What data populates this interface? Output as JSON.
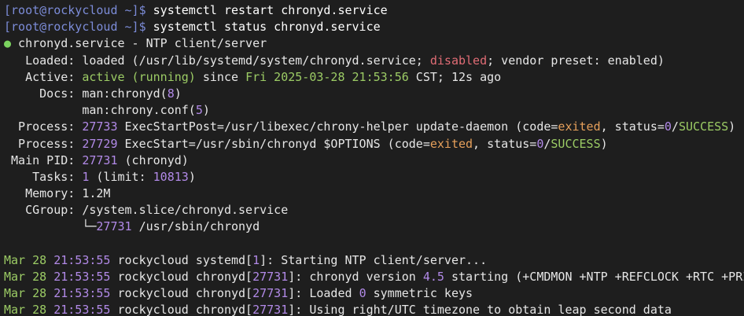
{
  "terminal": {
    "prompt_1": "[root@rockycloud ~]$ ",
    "command_1": "systemctl restart chronyd.service",
    "prompt_2": "[root@rockycloud ~]$ ",
    "command_2": "systemctl status chronyd.service",
    "service_dot": "●",
    "service_header": " chronyd.service - NTP client/server",
    "loaded_label": "   Loaded: ",
    "loaded_pre": "loaded (/usr/lib/systemd/system/chronyd.service; ",
    "loaded_disabled": "disabled",
    "loaded_post": "; vendor preset: enabled)",
    "active_label": "   Active: ",
    "active_status": "active (running)",
    "active_since": " since ",
    "active_time": "Fri 2025-03-28 21:53:56",
    "active_rest": " CST; 12s ago",
    "docs_label": "     Docs: ",
    "docs_1_pre": "man:chronyd(",
    "docs_1_num": "8",
    "docs_1_post": ")",
    "docs_2_pre": "           man:chrony.conf(",
    "docs_2_num": "5",
    "docs_2_post": ")",
    "process_1_label": "  Process: ",
    "process_1_pid": "27733",
    "process_1_cmd": " ExecStartPost=/usr/libexec/chrony-helper update-daemon (code=",
    "process_1_code": "exited",
    "process_1_mid": ", status=",
    "process_1_status_num": "0",
    "process_1_slash": "/",
    "process_1_success": "SUCCESS",
    "process_1_end": ")",
    "process_2_label": "  Process: ",
    "process_2_pid": "27729",
    "process_2_cmd": " ExecStart=/usr/sbin/chronyd $OPTIONS (code=",
    "process_2_code": "exited",
    "process_2_mid": ", status=",
    "process_2_status_num": "0",
    "process_2_slash": "/",
    "process_2_success": "SUCCESS",
    "process_2_end": ")",
    "mainpid_label": " Main PID: ",
    "mainpid_num": "27731",
    "mainpid_name": " (chronyd)",
    "tasks_label": "    Tasks: ",
    "tasks_num": "1",
    "tasks_limit_pre": " (limit: ",
    "tasks_limit": "10813",
    "tasks_limit_post": ")",
    "memory_label": "   Memory: ",
    "memory_value": "1.2M",
    "cgroup_label": "   CGroup: ",
    "cgroup_value": "/system.slice/chronyd.service",
    "cgroup_tree_prefix": "           └─",
    "cgroup_tree_pid": "27731",
    "cgroup_tree_cmd": " /usr/sbin/chronyd",
    "log_1_date": "Mar 28 ",
    "log_1_time": "21:53:55",
    "log_1_host": " rockycloud systemd[",
    "log_1_pid": "1",
    "log_1_msg": "]: Starting NTP client/server...",
    "log_2_date": "Mar 28 ",
    "log_2_time": "21:53:55",
    "log_2_host": " rockycloud chronyd[",
    "log_2_pid": "27731",
    "log_2_msg_1": "]: chronyd version ",
    "log_2_version": "4.5",
    "log_2_msg_2": " starting (+CMDMON +NTP +REFCLOCK +RTC +PRI",
    "log_3_date": "Mar 28 ",
    "log_3_time": "21:53:55",
    "log_3_host": " rockycloud chronyd[",
    "log_3_pid": "27731",
    "log_3_msg_1": "]: Loaded ",
    "log_3_count": "0",
    "log_3_msg_2": " symmetric keys",
    "log_4_date": "Mar 28 ",
    "log_4_time": "21:53:55",
    "log_4_host": " rockycloud chronyd[",
    "log_4_pid": "27731",
    "log_4_msg": "]: Using right/UTC timezone to obtain leap second data"
  }
}
